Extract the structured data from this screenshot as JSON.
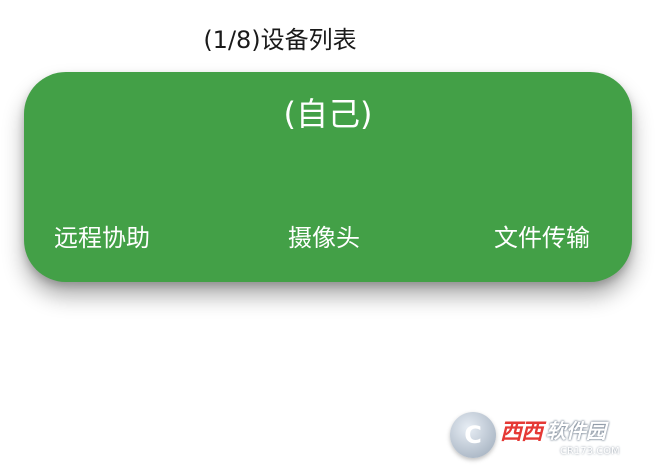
{
  "header": {
    "title": "(1/8)设备列表"
  },
  "device_card": {
    "name": "(自己)",
    "color": "#43a047",
    "actions": [
      {
        "label": "远程协助"
      },
      {
        "label": "摄像头"
      },
      {
        "label": "文件传输"
      }
    ]
  },
  "watermark": {
    "logo_letter": "C",
    "brand_red": "西西",
    "brand_white": "软件园",
    "domain": "CR173.COM"
  }
}
